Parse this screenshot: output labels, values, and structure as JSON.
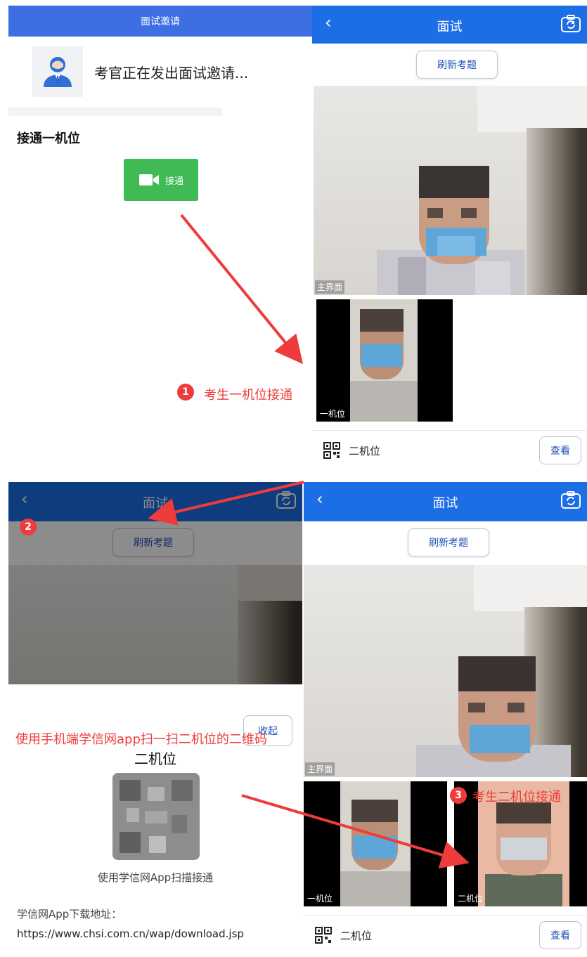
{
  "invite_panel": {
    "header_title": "面试邀请",
    "status_text": "考官正在发出面试邀请...",
    "section_title": "接通一机位",
    "connect_label": "接通"
  },
  "interview_screen": {
    "back_glyph": "‹",
    "title": "面试",
    "refresh_label": "刷新考题",
    "main_video_tag": "主界面",
    "slot1_tag": "一机位",
    "slot2_tag": "二机位",
    "qr_row_label": "二机位",
    "view_label": "查看"
  },
  "qr_panel": {
    "collapse_label": "收起",
    "slot_title": "二机位",
    "scan_caption": "使用学信网App扫描接通",
    "download_label": "学信网App下载地址：",
    "download_url": "https://www.chsi.com.cn/wap/download.jsp"
  },
  "annotations": {
    "step1_number": "1",
    "step1_text": "考生一机位接通",
    "step2_number": "2",
    "step2_text": "使用手机端学信网app扫一扫二机位的二维码",
    "step3_number": "3",
    "step3_text": "考生二机位接通"
  },
  "colors": {
    "header_blue": "#1c6ee6",
    "invite_bar_blue": "#3d6fe3",
    "connect_green": "#3fba55",
    "annotation_red": "#ee3b3b",
    "link_blue": "#1d4fb8"
  }
}
